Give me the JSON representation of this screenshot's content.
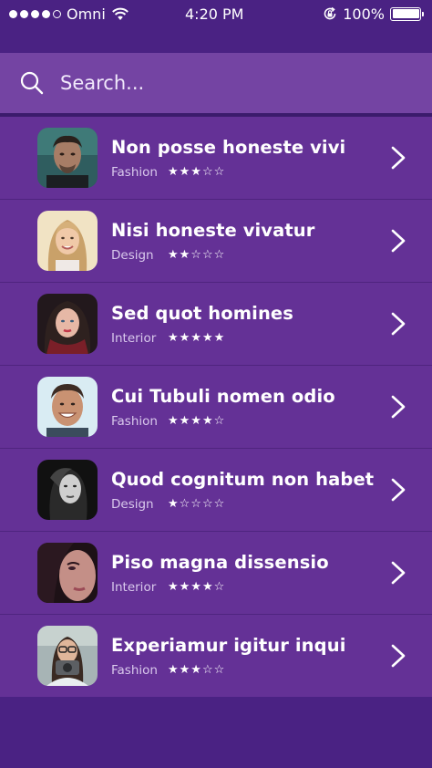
{
  "status_bar": {
    "carrier": "Omni",
    "time": "4:20 PM",
    "battery": "100%",
    "signal_dots_filled": 4,
    "signal_dots_total": 5,
    "battery_level": 1.0
  },
  "search": {
    "placeholder": "Search..."
  },
  "colors": {
    "background": "#4a2283",
    "search_bar": "#7444a3",
    "list_bg": "#643196",
    "divider": "#4f247f"
  },
  "items": [
    {
      "title": "Non posse honeste vivi",
      "category": "Fashion",
      "rating": 3,
      "stars": "★★★☆☆",
      "avatar_icon": "man-portrait-avatar"
    },
    {
      "title": "Nisi honeste vivatur",
      "category": "Design",
      "rating": 2,
      "stars": "★★☆☆☆",
      "avatar_icon": "woman-blonde-avatar"
    },
    {
      "title": "Sed quot homines",
      "category": "Interior",
      "rating": 5,
      "stars": "★★★★★",
      "avatar_icon": "woman-dark-hair-avatar"
    },
    {
      "title": "Cui Tubuli nomen odio",
      "category": "Fashion",
      "rating": 4,
      "stars": "★★★★☆",
      "avatar_icon": "man-smiling-avatar"
    },
    {
      "title": "Quod cognitum non habet",
      "category": "Design",
      "rating": 1,
      "stars": "★☆☆☆☆",
      "avatar_icon": "woman-bw-avatar"
    },
    {
      "title": "Piso magna dissensio",
      "category": "Interior",
      "rating": 4,
      "stars": "★★★★☆",
      "avatar_icon": "woman-closeup-avatar"
    },
    {
      "title": "Experiamur igitur inqui",
      "category": "Fashion",
      "rating": 3,
      "stars": "★★★☆☆",
      "avatar_icon": "woman-camera-avatar"
    }
  ]
}
